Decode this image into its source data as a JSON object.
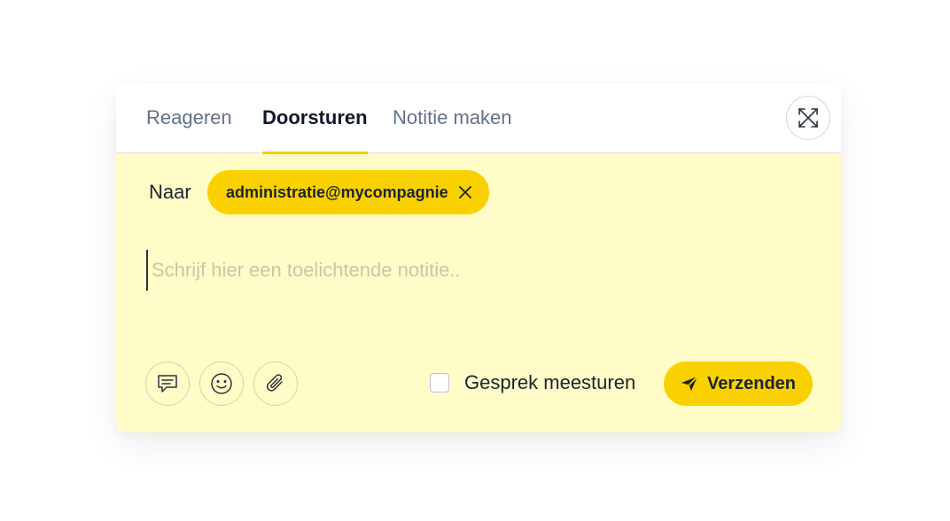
{
  "tabs": [
    {
      "label": "Reageren",
      "active": false
    },
    {
      "label": "Doorsturen",
      "active": true
    },
    {
      "label": "Notitie maken",
      "active": false
    }
  ],
  "expand_icon": "expand-arrows-icon",
  "recipients": {
    "label": "Naar",
    "chips": [
      {
        "text": "administratie@mycompagnie"
      }
    ]
  },
  "note": {
    "value": "",
    "placeholder": "Schrijf hier een toelichtende notitie.."
  },
  "toolbar": {
    "icons": [
      "message-icon",
      "emoji-icon",
      "paperclip-icon"
    ]
  },
  "include_conversation": {
    "label": "Gesprek meesturen",
    "checked": false
  },
  "send": {
    "label": "Verzenden",
    "icon": "send-icon"
  },
  "colors": {
    "accent": "#f9d100",
    "compose_background": "#fffcc7",
    "tab_inactive": "#5e7388",
    "tab_active": "#0e1a2b"
  }
}
